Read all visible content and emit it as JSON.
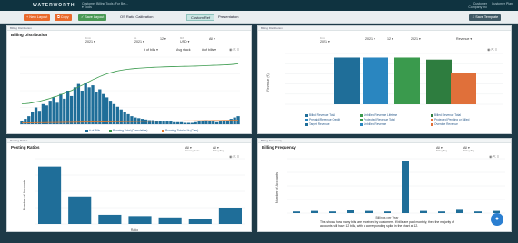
{
  "app": {
    "logo": "WATERWORTH",
    "subtitle_line1": "Customer Billing Tools (For Bet...",
    "subtitle_line2": "▾ Tools",
    "user_line1": "Customer",
    "user_line2": "Company Inc",
    "user_name": "Customer Plan"
  },
  "toolbar": {
    "new_layout": "+ New Layout",
    "copy": "⧉ Copy",
    "save_layout": "✓ Save Layout",
    "tab_ratio": "OS Ratio Calibration",
    "tab_custom": "Custom Ref",
    "tab_presentation": "Presentation",
    "save_template": "⬇ Save Template"
  },
  "panels": {
    "billing_dist": {
      "header": "Billing Distribution",
      "title": "Billing Distribution",
      "filters": [
        {
          "cap": "From",
          "value": "2021 ▾"
        },
        {
          "cap": "to",
          "value": "2021 ▾"
        },
        {
          "cap": "",
          "value": "12 ▾"
        },
        {
          "cap": "Mth",
          "value": "USD ▾"
        },
        {
          "cap": "",
          "value": "All ▾"
        }
      ],
      "subfilters": [
        "# of bills ▾",
        "Avg stack",
        "# of bills ▾"
      ],
      "legend": [
        "# of Bills",
        "Running Total (Cumulative)",
        "Running Total in % (Cum)"
      ],
      "colors": {
        "bars": "#1f6e99",
        "green": "#3a9a4d",
        "orange": "#e87a2a"
      }
    },
    "revenue_dist": {
      "header": "Billing Distribution",
      "title": "",
      "filters": [
        {
          "cap": "From",
          "value": "2021 ▾"
        },
        {
          "cap": "",
          "value": "2021 ▾"
        },
        {
          "cap": "",
          "value": "12 ▾"
        },
        {
          "cap": "",
          "value": "2021 ▾"
        },
        {
          "cap": "",
          "value": "Revenue ▾"
        }
      ],
      "ylabel": "Revenue (€)",
      "bar_colors": [
        "#1f6e99",
        "#2a86c0",
        "#3a9a4d",
        "#2e7d3f",
        "#e0703a"
      ],
      "bar_levels": [
        0.92,
        0.92,
        0.92,
        0.88,
        0.62
      ],
      "legend": [
        {
          "label": "Billed Revenue Total",
          "color": "#1f6e99"
        },
        {
          "label": "Unbilled Revenue Lifetime",
          "color": "#3a9a4d"
        },
        {
          "label": "Billed Revenue Total",
          "color": "#2e7d3f"
        },
        {
          "label": "Prepaid/Revenue Credit",
          "color": "#2a86c0"
        },
        {
          "label": "Projected Revenue Total",
          "color": "#3a9a4d"
        },
        {
          "label": "Projected Pending or Billed",
          "color": "#e0703a"
        },
        {
          "label": "Target Revenue",
          "color": "#1f6e99"
        },
        {
          "label": "Unbilled Revenue",
          "color": "#2a86c0"
        },
        {
          "label": "Overdue Revenue",
          "color": "#e0703a"
        }
      ]
    },
    "posting_ratios": {
      "header": "Posting Ratios",
      "title": "Posting Ratios",
      "filter": {
        "cap": "Posting Ratio",
        "value": "All ▾"
      },
      "filter2": {
        "cap": "Billing Bkg",
        "value": "All ▾"
      },
      "ylabel": "Number of Accounts",
      "xlabel": "Ratio",
      "levels": [
        0.88,
        0.42,
        0.14,
        0.12,
        0.1,
        0.08,
        0.25
      ],
      "color": "#1f6e99"
    },
    "billing_freq": {
      "header": "Billing Frequency",
      "title": "Billing Frequency",
      "filter": {
        "cap": "Billing Bkg",
        "value": "All ▾"
      },
      "filter2": {
        "cap": "Billing Bkg",
        "value": "All ▾"
      },
      "ylabel": "Number of Accounts",
      "xlabel": "Billings per Year",
      "levels": [
        0.03,
        0.04,
        0.03,
        0.05,
        0.04,
        0.03,
        0.95,
        0.04,
        0.03,
        0.06,
        0.03,
        0.04
      ],
      "color": "#1f6e99",
      "note": "This shows how many bills are received by customers. If bills are paid monthly, then the majority of accounts will have 12 bills, with a corresponding spike in the chart at 12."
    }
  },
  "chat_icon": "●"
}
